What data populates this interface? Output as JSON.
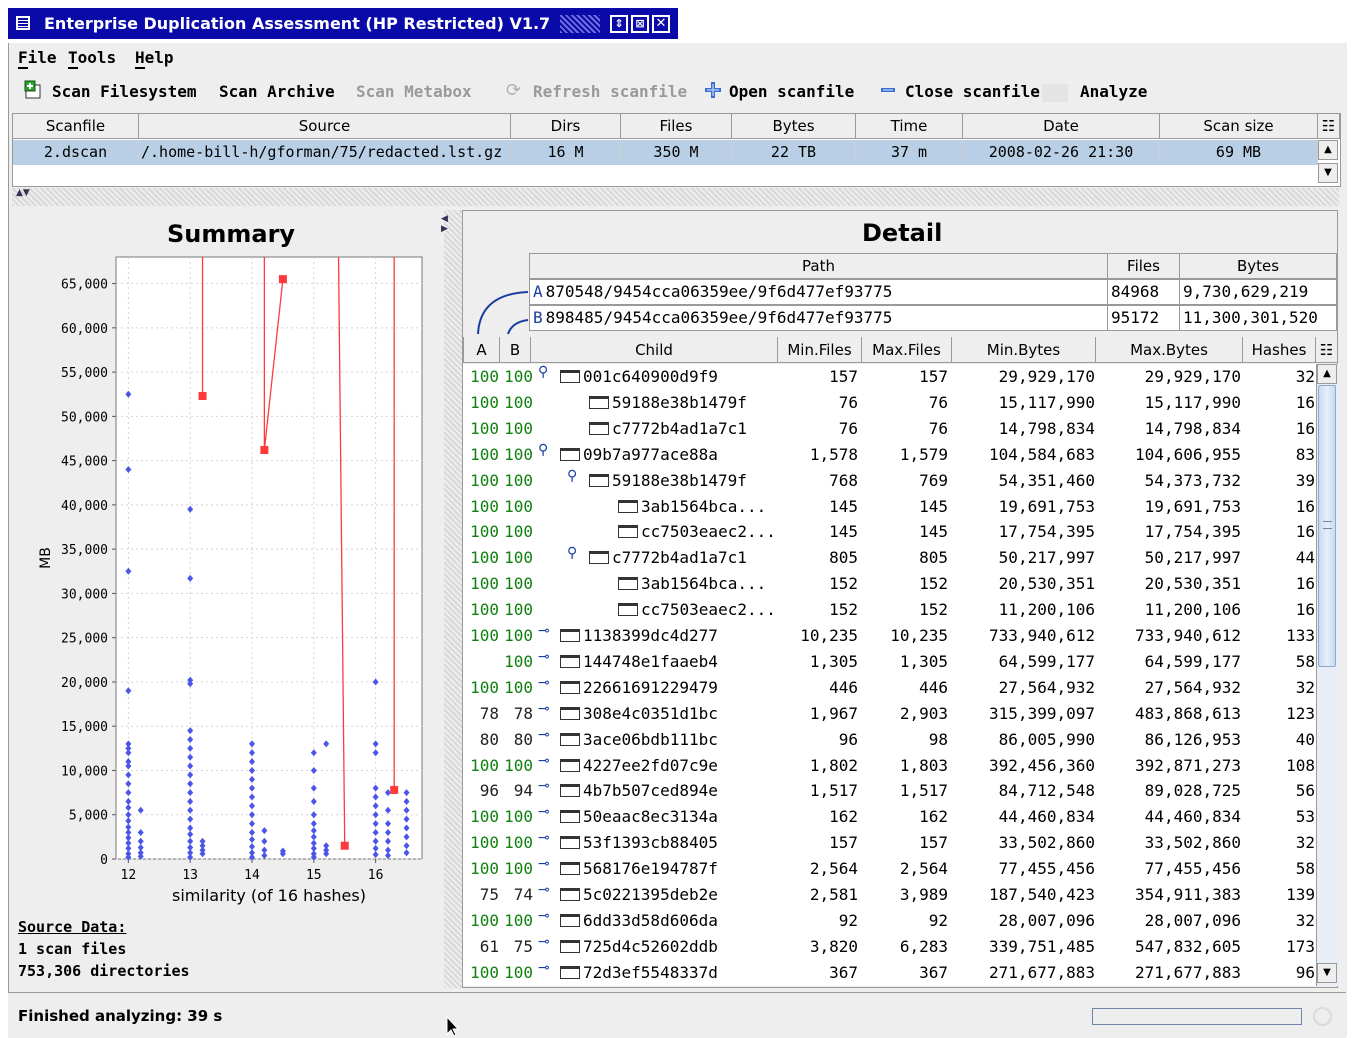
{
  "window": {
    "title": "Enterprise Duplication Assessment  (HP Restricted)  V1.7",
    "controls": [
      "restore-icon",
      "maximize-icon",
      "close-icon"
    ]
  },
  "menu": {
    "file": "File",
    "tools": "Tools",
    "help": "Help"
  },
  "toolbar": {
    "scan_filesystem": "Scan Filesystem",
    "scan_archive": "Scan Archive",
    "scan_metabox": "Scan Metabox",
    "refresh_scanfile": "Refresh scanfile",
    "open_scanfile": "Open scanfile",
    "close_scanfile": "Close scanfile",
    "analyze": "Analyze"
  },
  "scan_table": {
    "headers": [
      "Scanfile",
      "Source",
      "Dirs",
      "Files",
      "Bytes",
      "Time",
      "Date",
      "Scan size"
    ],
    "row": [
      "2.dscan",
      "/.home-bill-h/gforman/75/redacted.lst.gz",
      "16 M",
      "350 M",
      "22 TB",
      "37 m",
      "2008-02-26 21:30",
      "69 MB"
    ]
  },
  "summary": {
    "title": "Summary",
    "source_label": "Source Data:",
    "scan_files": "1 scan files",
    "directories": "753,306 directories"
  },
  "chart_data": {
    "type": "scatter",
    "title": "Summary",
    "xlabel": "similarity (of 16 hashes)",
    "ylabel": "MB",
    "xlim": [
      11.8,
      16.75
    ],
    "ylim": [
      0,
      68000
    ],
    "x_ticks": [
      12,
      13,
      14,
      15,
      16
    ],
    "y_ticks": [
      0,
      5000,
      10000,
      15000,
      20000,
      25000,
      30000,
      35000,
      40000,
      45000,
      50000,
      55000,
      60000,
      65000
    ],
    "y_tick_labels": [
      "0",
      "5,000",
      "10,000",
      "15,000",
      "20,000",
      "25,000",
      "30,000",
      "35,000",
      "40,000",
      "45,000",
      "50,000",
      "55,000",
      "60,000",
      "65,000"
    ],
    "grid": true,
    "series": [
      {
        "marker": "diamond",
        "color": "#4b55e8",
        "points": [
          [
            12,
            52500
          ],
          [
            12,
            44000
          ],
          [
            12,
            32500
          ],
          [
            12,
            19000
          ],
          [
            12,
            13000
          ],
          [
            12,
            12500
          ],
          [
            12,
            12000
          ],
          [
            12,
            11000
          ],
          [
            12,
            10500
          ],
          [
            12,
            9500
          ],
          [
            12,
            8500
          ],
          [
            12,
            7500
          ],
          [
            12,
            6500
          ],
          [
            12,
            5800
          ],
          [
            12,
            5000
          ],
          [
            12,
            4300
          ],
          [
            12,
            3600
          ],
          [
            12,
            3000
          ],
          [
            12,
            2400
          ],
          [
            12,
            1800
          ],
          [
            12,
            1200
          ],
          [
            12,
            600
          ],
          [
            12,
            200
          ],
          [
            12.2,
            5500
          ],
          [
            12.2,
            3000
          ],
          [
            12.2,
            2000
          ],
          [
            12.2,
            1300
          ],
          [
            12.2,
            700
          ],
          [
            12.2,
            300
          ],
          [
            13,
            39500
          ],
          [
            13,
            31700
          ],
          [
            13,
            20200
          ],
          [
            13,
            19800
          ],
          [
            13,
            14500
          ],
          [
            13,
            13500
          ],
          [
            13,
            12500
          ],
          [
            13,
            11500
          ],
          [
            13,
            10500
          ],
          [
            13,
            9500
          ],
          [
            13,
            8500
          ],
          [
            13,
            7500
          ],
          [
            13,
            6500
          ],
          [
            13,
            5500
          ],
          [
            13,
            4500
          ],
          [
            13,
            3500
          ],
          [
            13,
            2800
          ],
          [
            13,
            2000
          ],
          [
            13,
            1300
          ],
          [
            13,
            700
          ],
          [
            13,
            200
          ],
          [
            13.2,
            2000
          ],
          [
            13.2,
            1500
          ],
          [
            13.2,
            1000
          ],
          [
            13.2,
            600
          ],
          [
            14,
            13000
          ],
          [
            14,
            12000
          ],
          [
            14,
            11000
          ],
          [
            14,
            10000
          ],
          [
            14,
            9000
          ],
          [
            14,
            8000
          ],
          [
            14,
            7000
          ],
          [
            14,
            6000
          ],
          [
            14,
            5000
          ],
          [
            14,
            4000
          ],
          [
            14,
            3000
          ],
          [
            14,
            2200
          ],
          [
            14,
            1400
          ],
          [
            14,
            700
          ],
          [
            14,
            200
          ],
          [
            14.2,
            3200
          ],
          [
            14.2,
            2000
          ],
          [
            14.2,
            1000
          ],
          [
            14.2,
            400
          ],
          [
            14.5,
            900
          ],
          [
            14.5,
            600
          ],
          [
            15,
            12000
          ],
          [
            15,
            10000
          ],
          [
            15,
            8000
          ],
          [
            15,
            6500
          ],
          [
            15,
            5000
          ],
          [
            15,
            4000
          ],
          [
            15,
            3200
          ],
          [
            15,
            2500
          ],
          [
            15,
            1800
          ],
          [
            15,
            1200
          ],
          [
            15,
            600
          ],
          [
            15,
            200
          ],
          [
            15.2,
            13000
          ],
          [
            15.2,
            1500
          ],
          [
            15.2,
            1000
          ],
          [
            15.2,
            600
          ],
          [
            16,
            20000
          ],
          [
            16,
            13000
          ],
          [
            16,
            12000
          ],
          [
            16,
            8000
          ],
          [
            16,
            7000
          ],
          [
            16,
            6000
          ],
          [
            16,
            5000
          ],
          [
            16,
            4000
          ],
          [
            16,
            3000
          ],
          [
            16,
            2000
          ],
          [
            16,
            1200
          ],
          [
            16,
            500
          ],
          [
            16.2,
            7500
          ],
          [
            16.2,
            5500
          ],
          [
            16.2,
            4000
          ],
          [
            16.2,
            3000
          ],
          [
            16.2,
            2000
          ],
          [
            16.2,
            1000
          ],
          [
            16.2,
            400
          ],
          [
            16.5,
            7500
          ],
          [
            16.5,
            6500
          ],
          [
            16.5,
            5500
          ],
          [
            16.5,
            4500
          ],
          [
            16.5,
            3500
          ],
          [
            16.5,
            2500
          ],
          [
            16.5,
            1500
          ],
          [
            16.5,
            700
          ]
        ]
      },
      {
        "marker": "square",
        "color": "#ff3a3a",
        "segments": [
          [
            [
              13.2,
              52300
            ],
            [
              13.2,
              68000
            ]
          ],
          [
            [
              14.2,
              46200
            ],
            [
              14.2,
              68000
            ]
          ],
          [
            [
              14.5,
              65500
            ],
            [
              14.2,
              46200
            ]
          ],
          [
            [
              15.5,
              1500
            ],
            [
              15.4,
              68000
            ]
          ],
          [
            [
              16.3,
              7800
            ],
            [
              16.3,
              68000
            ]
          ]
        ],
        "points": [
          [
            13.2,
            52300
          ],
          [
            14.2,
            46200
          ],
          [
            14.5,
            65500
          ],
          [
            15.5,
            1500
          ],
          [
            16.3,
            7800
          ]
        ]
      }
    ]
  },
  "detail": {
    "title": "Detail",
    "path_headers": [
      "Path",
      "Files",
      "Bytes"
    ],
    "path_rows": [
      {
        "label": "A",
        "path": "870548/9454cca06359ee/9f6d477ef93775",
        "files": "84968",
        "bytes": "9,730,629,219"
      },
      {
        "label": "B",
        "path": "898485/9454cca06359ee/9f6d477ef93775",
        "files": "95172",
        "bytes": "11,300,301,520"
      }
    ],
    "child_headers": [
      "A",
      "B",
      "Child",
      "Min.Files",
      "Max.Files",
      "Min.Bytes",
      "Max.Bytes",
      "Hashes"
    ],
    "rows": [
      {
        "a": "100",
        "b": "100",
        "key": "⚲",
        "indent": 0,
        "name": "001c640900d9f9",
        "minf": "157",
        "maxf": "157",
        "minb": "29,929,170",
        "maxb": "29,929,170",
        "h": "32"
      },
      {
        "a": "100",
        "b": "100",
        "key": "",
        "indent": 1,
        "name": "59188e38b1479f",
        "minf": "76",
        "maxf": "76",
        "minb": "15,117,990",
        "maxb": "15,117,990",
        "h": "16"
      },
      {
        "a": "100",
        "b": "100",
        "key": "",
        "indent": 1,
        "name": "c7772b4ad1a7c1",
        "minf": "76",
        "maxf": "76",
        "minb": "14,798,834",
        "maxb": "14,798,834",
        "h": "16"
      },
      {
        "a": "100",
        "b": "100",
        "key": "⚲",
        "indent": 0,
        "name": "09b7a977ace88a",
        "minf": "1,578",
        "maxf": "1,579",
        "minb": "104,584,683",
        "maxb": "104,606,955",
        "h": "83"
      },
      {
        "a": "100",
        "b": "100",
        "key": "⚲",
        "indent": 1,
        "name": "59188e38b1479f",
        "minf": "768",
        "maxf": "769",
        "minb": "54,351,460",
        "maxb": "54,373,732",
        "h": "39"
      },
      {
        "a": "100",
        "b": "100",
        "key": "",
        "indent": 2,
        "name": "3ab1564bca...",
        "minf": "145",
        "maxf": "145",
        "minb": "19,691,753",
        "maxb": "19,691,753",
        "h": "16"
      },
      {
        "a": "100",
        "b": "100",
        "key": "",
        "indent": 2,
        "name": "cc7503eaec2...",
        "minf": "145",
        "maxf": "145",
        "minb": "17,754,395",
        "maxb": "17,754,395",
        "h": "16"
      },
      {
        "a": "100",
        "b": "100",
        "key": "⚲",
        "indent": 1,
        "name": "c7772b4ad1a7c1",
        "minf": "805",
        "maxf": "805",
        "minb": "50,217,997",
        "maxb": "50,217,997",
        "h": "44"
      },
      {
        "a": "100",
        "b": "100",
        "key": "",
        "indent": 2,
        "name": "3ab1564bca...",
        "minf": "152",
        "maxf": "152",
        "minb": "20,530,351",
        "maxb": "20,530,351",
        "h": "16"
      },
      {
        "a": "100",
        "b": "100",
        "key": "",
        "indent": 2,
        "name": "cc7503eaec2...",
        "minf": "152",
        "maxf": "152",
        "minb": "11,200,106",
        "maxb": "11,200,106",
        "h": "16"
      },
      {
        "a": "100",
        "b": "100",
        "key": "⊸",
        "indent": 0,
        "name": "1138399dc4d277",
        "minf": "10,235",
        "maxf": "10,235",
        "minb": "733,940,612",
        "maxb": "733,940,612",
        "h": "133"
      },
      {
        "a": "",
        "b": "100",
        "key": "⊸",
        "indent": 0,
        "name": "144748e1faaeb4",
        "minf": "1,305",
        "maxf": "1,305",
        "minb": "64,599,177",
        "maxb": "64,599,177",
        "h": "58"
      },
      {
        "a": "100",
        "b": "100",
        "key": "⊸",
        "indent": 0,
        "name": "22661691229479",
        "minf": "446",
        "maxf": "446",
        "minb": "27,564,932",
        "maxb": "27,564,932",
        "h": "32"
      },
      {
        "a": "78",
        "b": "78",
        "key": "⊸",
        "indent": 0,
        "name": "308e4c0351d1bc",
        "minf": "1,967",
        "maxf": "2,903",
        "minb": "315,399,097",
        "maxb": "483,868,613",
        "h": "123"
      },
      {
        "a": "80",
        "b": "80",
        "key": "⊸",
        "indent": 0,
        "name": "3ace06bdb111bc",
        "minf": "96",
        "maxf": "98",
        "minb": "86,005,990",
        "maxb": "86,126,953",
        "h": "40"
      },
      {
        "a": "100",
        "b": "100",
        "key": "⊸",
        "indent": 0,
        "name": "4227ee2fd07c9e",
        "minf": "1,802",
        "maxf": "1,803",
        "minb": "392,456,360",
        "maxb": "392,871,273",
        "h": "108"
      },
      {
        "a": "96",
        "b": "94",
        "key": "⊸",
        "indent": 0,
        "name": "4b7b507ced894e",
        "minf": "1,517",
        "maxf": "1,517",
        "minb": "84,712,548",
        "maxb": "89,028,725",
        "h": "56"
      },
      {
        "a": "100",
        "b": "100",
        "key": "⊸",
        "indent": 0,
        "name": "50eaac8ec3134a",
        "minf": "162",
        "maxf": "162",
        "minb": "44,460,834",
        "maxb": "44,460,834",
        "h": "53"
      },
      {
        "a": "100",
        "b": "100",
        "key": "⊸",
        "indent": 0,
        "name": "53f1393cb88405",
        "minf": "157",
        "maxf": "157",
        "minb": "33,502,860",
        "maxb": "33,502,860",
        "h": "32"
      },
      {
        "a": "100",
        "b": "100",
        "key": "⊸",
        "indent": 0,
        "name": "568176e194787f",
        "minf": "2,564",
        "maxf": "2,564",
        "minb": "77,455,456",
        "maxb": "77,455,456",
        "h": "58"
      },
      {
        "a": "75",
        "b": "74",
        "key": "⊸",
        "indent": 0,
        "name": "5c0221395deb2e",
        "minf": "2,581",
        "maxf": "3,989",
        "minb": "187,540,423",
        "maxb": "354,911,383",
        "h": "139"
      },
      {
        "a": "100",
        "b": "100",
        "key": "⊸",
        "indent": 0,
        "name": "6dd33d58d606da",
        "minf": "92",
        "maxf": "92",
        "minb": "28,007,096",
        "maxb": "28,007,096",
        "h": "32"
      },
      {
        "a": "61",
        "b": "75",
        "key": "⊸",
        "indent": 0,
        "name": "725d4c52602ddb",
        "minf": "3,820",
        "maxf": "6,283",
        "minb": "339,751,485",
        "maxb": "547,832,605",
        "h": "173"
      },
      {
        "a": "100",
        "b": "100",
        "key": "⊸",
        "indent": 0,
        "name": "72d3ef5548337d",
        "minf": "367",
        "maxf": "367",
        "minb": "271,677,883",
        "maxb": "271,677,883",
        "h": "96"
      }
    ]
  },
  "status": {
    "message": "Finished analyzing: 39 s",
    "progress": 0
  }
}
